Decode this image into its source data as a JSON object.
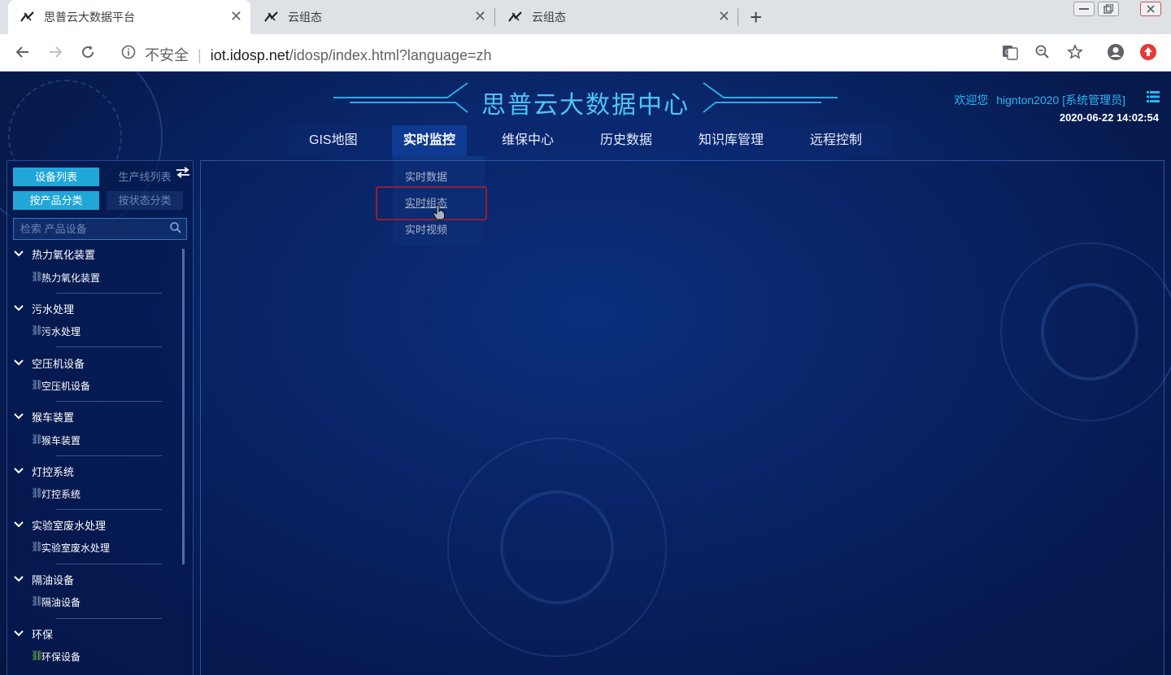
{
  "browser": {
    "tabs": [
      {
        "label": "思普云大数据平台",
        "active": true
      },
      {
        "label": "云组态",
        "active": false
      },
      {
        "label": "云组态",
        "active": false
      }
    ],
    "security_label": "不安全",
    "url_host": "iot.idosp.net",
    "url_path": "/idosp/index.html?language=zh"
  },
  "header": {
    "title": "思普云大数据中心",
    "welcome": "欢迎您",
    "username": "hignton2020",
    "role": "[系统管理员]",
    "datetime": "2020-06-22 14:02:54"
  },
  "nav": {
    "items": [
      "GIS地图",
      "实时监控",
      "维保中心",
      "历史数据",
      "知识库管理",
      "远程控制"
    ],
    "active": "实时监控",
    "dropdown": [
      "实时数据",
      "实时组态",
      "实时视频"
    ],
    "hovered": "实时组态"
  },
  "sidebar": {
    "tab_device_list": "设备列表",
    "tab_production_line": "生产线列表",
    "tab_by_product": "按产品分类",
    "tab_by_status": "按状态分类",
    "search_placeholder": "检索 产品设备",
    "groups": [
      {
        "name": "热力氧化装置",
        "children": [
          "热力氧化装置"
        ]
      },
      {
        "name": "污水处理",
        "children": [
          "污水处理"
        ]
      },
      {
        "name": "空压机设备",
        "children": [
          "空压机设备"
        ]
      },
      {
        "name": "猴车装置",
        "children": [
          "猴车装置"
        ]
      },
      {
        "name": "灯控系统",
        "children": [
          "灯控系统"
        ]
      },
      {
        "name": "实验室废水处理",
        "children": [
          "实验室废水处理"
        ]
      },
      {
        "name": "隔油设备",
        "children": [
          "隔油设备"
        ]
      },
      {
        "name": "环保",
        "children": [
          "环保设备"
        ]
      }
    ]
  },
  "colors": {
    "accent": "#21a6d8",
    "title": "#4fc3f7",
    "highlight_box": "#e02020"
  }
}
